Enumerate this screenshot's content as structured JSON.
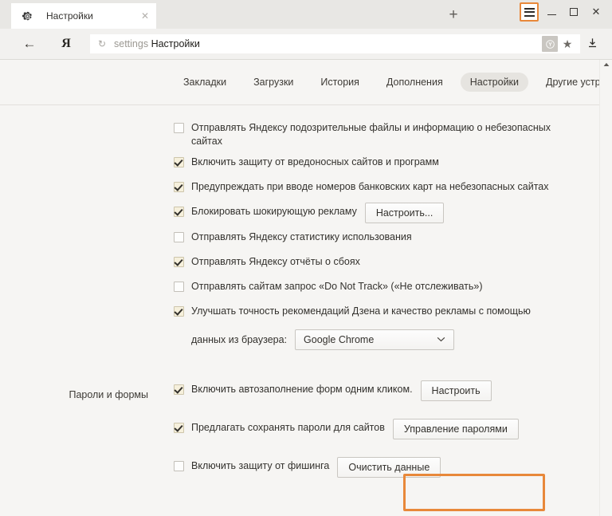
{
  "browser": {
    "tab": {
      "title": "Настройки",
      "favicon": "gear-icon",
      "close": "✕"
    },
    "new_tab_label": "+",
    "window_controls": {
      "menu": "hamburger-menu-icon",
      "minimize": "—",
      "maximize": "▢",
      "close": "✕"
    },
    "toolbar": {
      "back": "←",
      "yandex_logo": "Я",
      "reload": "↻",
      "url_scheme": "settings",
      "url_title": "Настройки",
      "badge": "Y",
      "bookmark_star": "★",
      "download": "⤓"
    },
    "accent_color": "#e8883a"
  },
  "settings_nav": {
    "items": [
      {
        "label": "Закладки",
        "active": false
      },
      {
        "label": "Загрузки",
        "active": false
      },
      {
        "label": "История",
        "active": false
      },
      {
        "label": "Дополнения",
        "active": false
      },
      {
        "label": "Настройки",
        "active": true
      },
      {
        "label": "Другие устройства",
        "active": false
      }
    ]
  },
  "sections": [
    {
      "label": "",
      "rows": [
        {
          "checked": false,
          "label": "Отправлять Яндексу подозрительные файлы и информацию о небезопасных сайтах",
          "button": null
        },
        {
          "checked": true,
          "label": "Включить защиту от вредоносных сайтов и программ",
          "button": null
        },
        {
          "checked": true,
          "label": "Предупреждать при вводе номеров банковских карт на небезопасных сайтах",
          "button": null
        },
        {
          "checked": true,
          "label": "Блокировать шокирующую рекламу",
          "button": "Настроить..."
        },
        {
          "checked": false,
          "label": "Отправлять Яндексу статистику использования",
          "button": null
        },
        {
          "checked": true,
          "label": "Отправлять Яндексу отчёты о сбоях",
          "button": null
        },
        {
          "checked": false,
          "label": "Отправлять сайтам запрос «Do Not Track» («Не отслеживать»)",
          "button": null
        },
        {
          "checked": true,
          "label": "Улучшать точность рекомендаций Дзена и качество рекламы с помощью",
          "button": null
        }
      ],
      "subrow": {
        "label": "данных из браузера:",
        "select_value": "Google Chrome",
        "caret": "⌄"
      }
    },
    {
      "label": "Пароли и формы",
      "rows": [
        {
          "checked": true,
          "label": "Включить автозаполнение форм одним кликом.",
          "button": "Настроить"
        },
        {
          "checked": true,
          "label": "Предлагать сохранять пароли для сайтов",
          "button": "Управление паролями"
        },
        {
          "checked": false,
          "label": "Включить защиту от фишинга",
          "button": "Очистить данные"
        }
      ]
    }
  ],
  "scrollbar": {
    "up_arrow": "▲"
  }
}
